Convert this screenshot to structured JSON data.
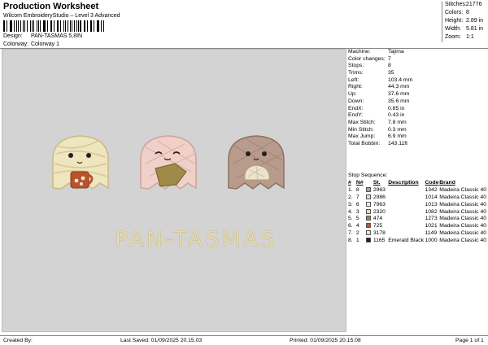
{
  "header": {
    "title": "Production Worksheet",
    "subtitle": "Wilcom EmbroideryStudio – Level 3 Advanced"
  },
  "design": {
    "design_label": "Design:",
    "design_value": "PAN-TASMAS 5,8IN",
    "colorway_label": "Colorway:",
    "colorway_value": "Colorway 1"
  },
  "stats": [
    {
      "label": "Stitches:",
      "value": "21776"
    },
    {
      "label": "Colors:",
      "value": "8"
    },
    {
      "label": "Height:",
      "value": "2.89 in"
    },
    {
      "label": "Width:",
      "value": "5.81 in"
    },
    {
      "label": "Zoom:",
      "value": "1:1"
    }
  ],
  "preview": {
    "text": "PAN-TASMAS"
  },
  "machine_info": [
    {
      "label": "Machine:",
      "value": "Tajima"
    },
    {
      "label": "Color changes:",
      "value": "7"
    },
    {
      "label": "Stops:",
      "value": "8"
    },
    {
      "label": "Trims:",
      "value": "35"
    },
    {
      "label": "Left:",
      "value": "103.4 mm"
    },
    {
      "label": "Right:",
      "value": "44.3 mm"
    },
    {
      "label": "Up:",
      "value": "37.6 mm"
    },
    {
      "label": "Down:",
      "value": "35.6 mm"
    },
    {
      "label": "EndX:",
      "value": "0.85 in"
    },
    {
      "label": "EndY:",
      "value": "0.43 in"
    },
    {
      "label": "Max Stitch:",
      "value": "7.8 mm"
    },
    {
      "label": "Min Stitch:",
      "value": "0.3 mm"
    },
    {
      "label": "Max Jump:",
      "value": "6.9 mm"
    },
    {
      "label": "Total Bobbin:",
      "value": "143.11ft"
    }
  ],
  "stop_sequence": {
    "heading": "Stop Sequence:",
    "columns": [
      "#",
      "N#",
      "",
      "St.",
      "Description",
      "Code",
      "Brand"
    ],
    "rows": [
      {
        "stop": "1.",
        "n": "8",
        "color": "#b7998c",
        "st": "2963",
        "desc": "",
        "code": "1342",
        "brand": "Madeira Classic 40"
      },
      {
        "stop": "2.",
        "n": "7",
        "color": "#f2d3cb",
        "st": "2986",
        "desc": "",
        "code": "1014",
        "brand": "Madeira Classic 40"
      },
      {
        "stop": "3.",
        "n": "6",
        "color": "#f4ecd6",
        "st": "7963",
        "desc": "",
        "code": "1013",
        "brand": "Madeira Classic 40"
      },
      {
        "stop": "4.",
        "n": "3",
        "color": "#e6d7c3",
        "st": "2320",
        "desc": "",
        "code": "1082",
        "brand": "Madeira Classic 40"
      },
      {
        "stop": "5.",
        "n": "5",
        "color": "#9b8746",
        "st": "474",
        "desc": "",
        "code": "1273",
        "brand": "Madeira Classic 40"
      },
      {
        "stop": "6.",
        "n": "4",
        "color": "#c0522f",
        "st": "725",
        "desc": "",
        "code": "1021",
        "brand": "Madeira Classic 40"
      },
      {
        "stop": "7.",
        "n": "2",
        "color": "#efe1c7",
        "st": "3178",
        "desc": "",
        "code": "1149",
        "brand": "Madeira Classic 40"
      },
      {
        "stop": "8.",
        "n": "1",
        "color": "#1e1e1e",
        "st": "1165",
        "desc": "Emerald Black",
        "code": "1000",
        "brand": "Madeira Classic 40"
      }
    ]
  },
  "footer": {
    "created_by": "Created By:",
    "last_saved": "Last Saved: 01/09/2025 20.15.03",
    "printed": "Printed: 01/09/2025 20.15.08",
    "page": "Page 1 of 1"
  }
}
